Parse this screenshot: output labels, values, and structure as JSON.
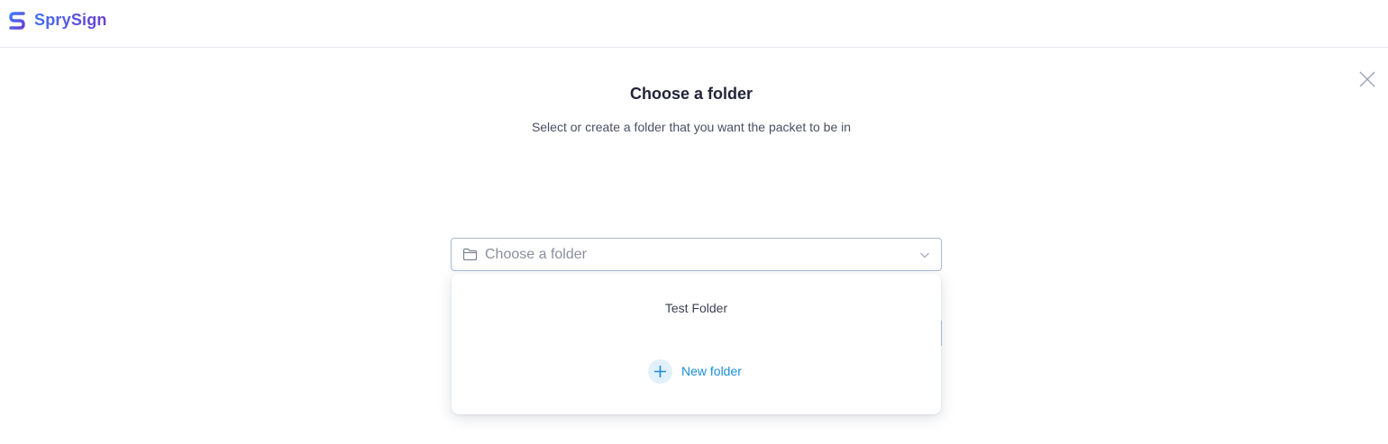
{
  "header": {
    "brand_name": "SprySign",
    "brand_colors": {
      "start": "#3f6ff2",
      "end": "#6a3fd6"
    }
  },
  "dialog": {
    "title": "Choose a folder",
    "subtitle": "Select or create a folder that you want the packet to be in",
    "close_icon": "close-icon"
  },
  "folder_select": {
    "placeholder": "Choose a folder",
    "icon": "folder-icon",
    "chevron": "chevron-down-icon",
    "options": [
      {
        "label": "Test Folder"
      }
    ],
    "new_folder_label": "New folder",
    "new_folder_icon": "plus-icon",
    "accent_color": "#1a8fd6"
  }
}
